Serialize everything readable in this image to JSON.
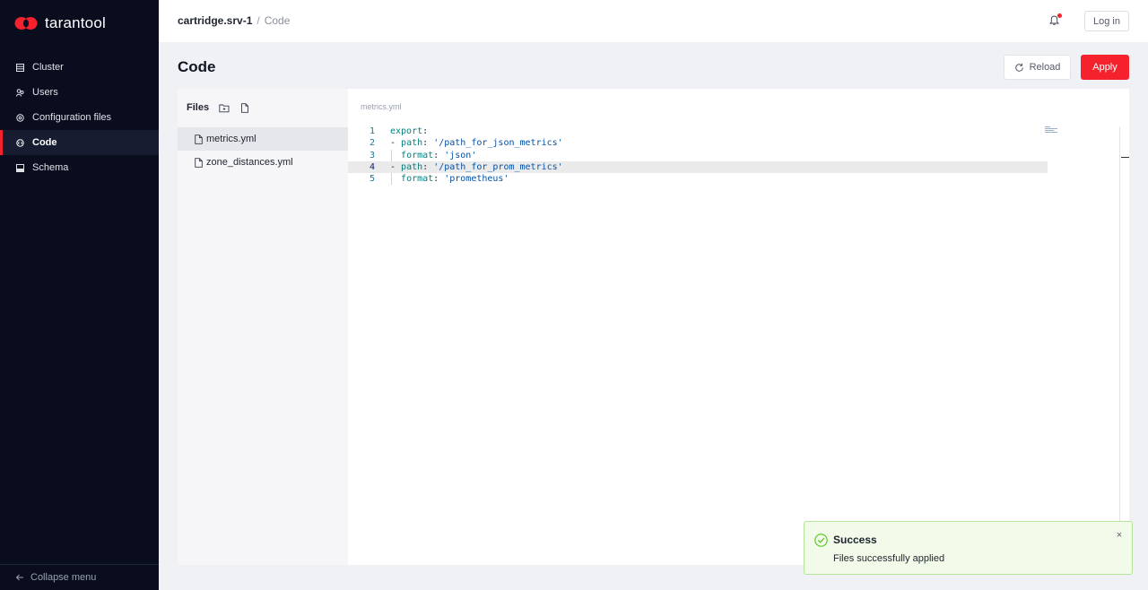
{
  "brand": {
    "name": "tarantool",
    "color": "#f5222d"
  },
  "sidebar": {
    "items": [
      {
        "label": "Cluster",
        "icon": "server-icon"
      },
      {
        "label": "Users",
        "icon": "users-icon"
      },
      {
        "label": "Configuration files",
        "icon": "gear-icon"
      },
      {
        "label": "Code",
        "icon": "code-icon",
        "active": true
      },
      {
        "label": "Schema",
        "icon": "schema-icon"
      }
    ],
    "collapse_label": "Collapse menu"
  },
  "header": {
    "server": "cartridge.srv-1",
    "separator": "/",
    "page": "Code",
    "login_label": "Log in",
    "notification_dot": true
  },
  "page": {
    "title": "Code",
    "reload_label": "Reload",
    "apply_label": "Apply"
  },
  "files": {
    "title": "Files",
    "items": [
      {
        "name": "metrics.yml",
        "active": true
      },
      {
        "name": "zone_distances.yml",
        "active": false
      }
    ]
  },
  "editor": {
    "tab": "metrics.yml",
    "current_line": 4,
    "lines": [
      {
        "n": "1",
        "key": "export",
        "rest": ":"
      },
      {
        "n": "2",
        "dash": "- ",
        "key": "path",
        "colon": ": ",
        "str": "'/path_for_json_metrics'"
      },
      {
        "n": "3",
        "indent": "  ",
        "key": "format",
        "colon": ": ",
        "str": "'json'"
      },
      {
        "n": "4",
        "dash": "- ",
        "key": "path",
        "colon": ": ",
        "str": "'/path_for_prom_metrics'"
      },
      {
        "n": "5",
        "indent": "  ",
        "key": "format",
        "colon": ": ",
        "str": "'prometheus'"
      }
    ]
  },
  "toast": {
    "title": "Success",
    "message": "Files successfully applied",
    "close": "×",
    "status_color": "#52c41a"
  }
}
